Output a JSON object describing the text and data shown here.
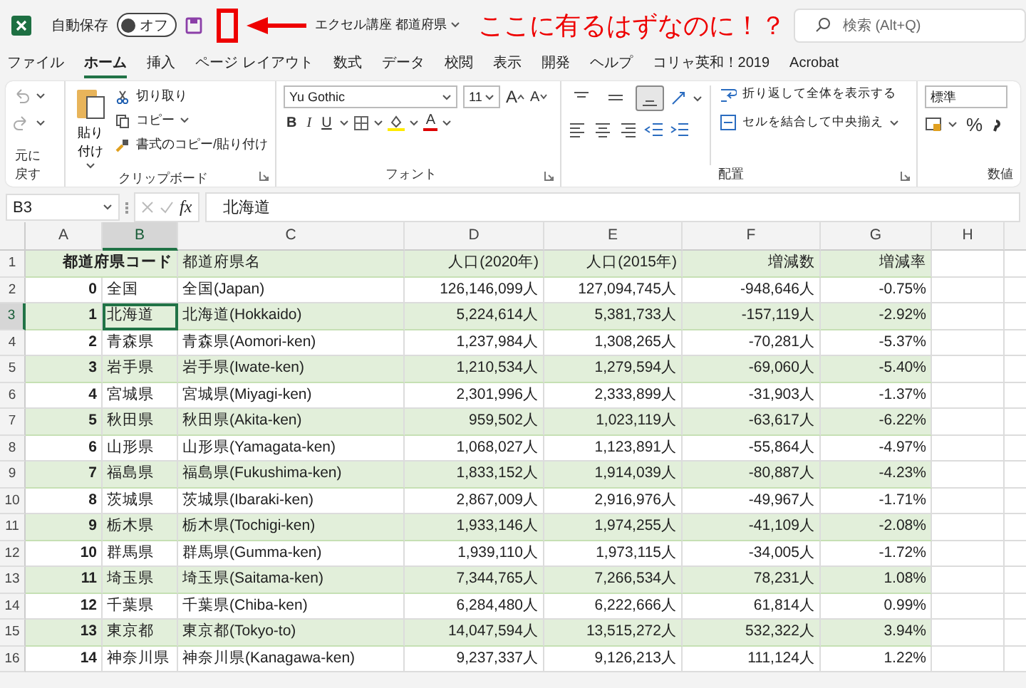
{
  "title_bar": {
    "autosave_label": "自動保存",
    "autosave": {
      "label": "オフ",
      "on": false
    },
    "document_title": "エクセル講座 都道府県",
    "search_placeholder": "検索 (Alt+Q)"
  },
  "annotation": {
    "text": "ここに有るはずなのに！？"
  },
  "ribbon_tabs": [
    {
      "label": "ファイル",
      "selected": false
    },
    {
      "label": "ホーム",
      "selected": true
    },
    {
      "label": "挿入",
      "selected": false
    },
    {
      "label": "ページ レイアウト",
      "selected": false
    },
    {
      "label": "数式",
      "selected": false
    },
    {
      "label": "データ",
      "selected": false
    },
    {
      "label": "校閲",
      "selected": false
    },
    {
      "label": "表示",
      "selected": false
    },
    {
      "label": "開発",
      "selected": false
    },
    {
      "label": "ヘルプ",
      "selected": false
    },
    {
      "label": "コリャ英和！2019",
      "selected": false
    },
    {
      "label": "Acrobat",
      "selected": false
    }
  ],
  "ribbon": {
    "undo_group": "元に戻す",
    "clipboard": {
      "paste": "貼り付け",
      "cut": "切り取り",
      "copy": "コピー",
      "format_painter": "書式のコピー/貼り付け",
      "label": "クリップボード"
    },
    "font": {
      "name": "Yu Gothic",
      "size": "11",
      "bold": "B",
      "italic": "I",
      "underline": "U",
      "grow": "A",
      "shrink": "A",
      "font_color_button": "A",
      "label": "フォント"
    },
    "alignment": {
      "vertical": [
        {
          "selected": false
        },
        {
          "selected": false
        },
        {
          "selected": true
        }
      ],
      "wrap": "折り返して全体を表示する",
      "merge": "セルを結合して中央揃え",
      "label": "配置"
    },
    "number": {
      "format": "標準",
      "percent": "%",
      "label": "数値"
    }
  },
  "formula_bar": {
    "name_box": "B3",
    "fx": "fx",
    "value": "北海道"
  },
  "sheet": {
    "columns": [
      {
        "label": "A",
        "selected": false
      },
      {
        "label": "B",
        "selected": true
      },
      {
        "label": "C",
        "selected": false
      },
      {
        "label": "D",
        "selected": false
      },
      {
        "label": "E",
        "selected": false
      },
      {
        "label": "F",
        "selected": false
      },
      {
        "label": "G",
        "selected": false
      },
      {
        "label": "H",
        "selected": false
      }
    ],
    "rows": [
      {
        "number": "1",
        "selected": false,
        "banded": true,
        "cells": [
          "都道府県コード",
          "",
          "都道府県名",
          "人口(2020年)",
          "人口(2015年)",
          "増減数",
          "増減率"
        ]
      },
      {
        "number": "2",
        "selected": false,
        "banded": false,
        "cells": [
          "0",
          "全国",
          "全国(Japan)",
          "126,146,099人",
          "127,094,745人",
          "-948,646人",
          "-0.75%"
        ]
      },
      {
        "number": "3",
        "selected": true,
        "banded": true,
        "cells": [
          "1",
          "北海道",
          "北海道(Hokkaido)",
          "5,224,614人",
          "5,381,733人",
          "-157,119人",
          "-2.92%"
        ]
      },
      {
        "number": "4",
        "selected": false,
        "banded": false,
        "cells": [
          "2",
          "青森県",
          "青森県(Aomori-ken)",
          "1,237,984人",
          "1,308,265人",
          "-70,281人",
          "-5.37%"
        ]
      },
      {
        "number": "5",
        "selected": false,
        "banded": true,
        "cells": [
          "3",
          "岩手県",
          "岩手県(Iwate-ken)",
          "1,210,534人",
          "1,279,594人",
          "-69,060人",
          "-5.40%"
        ]
      },
      {
        "number": "6",
        "selected": false,
        "banded": false,
        "cells": [
          "4",
          "宮城県",
          "宮城県(Miyagi-ken)",
          "2,301,996人",
          "2,333,899人",
          "-31,903人",
          "-1.37%"
        ]
      },
      {
        "number": "7",
        "selected": false,
        "banded": true,
        "cells": [
          "5",
          "秋田県",
          "秋田県(Akita-ken)",
          "959,502人",
          "1,023,119人",
          "-63,617人",
          "-6.22%"
        ]
      },
      {
        "number": "8",
        "selected": false,
        "banded": false,
        "cells": [
          "6",
          "山形県",
          "山形県(Yamagata-ken)",
          "1,068,027人",
          "1,123,891人",
          "-55,864人",
          "-4.97%"
        ]
      },
      {
        "number": "9",
        "selected": false,
        "banded": true,
        "cells": [
          "7",
          "福島県",
          "福島県(Fukushima-ken)",
          "1,833,152人",
          "1,914,039人",
          "-80,887人",
          "-4.23%"
        ]
      },
      {
        "number": "10",
        "selected": false,
        "banded": false,
        "cells": [
          "8",
          "茨城県",
          "茨城県(Ibaraki-ken)",
          "2,867,009人",
          "2,916,976人",
          "-49,967人",
          "-1.71%"
        ]
      },
      {
        "number": "11",
        "selected": false,
        "banded": true,
        "cells": [
          "9",
          "栃木県",
          "栃木県(Tochigi-ken)",
          "1,933,146人",
          "1,974,255人",
          "-41,109人",
          "-2.08%"
        ]
      },
      {
        "number": "12",
        "selected": false,
        "banded": false,
        "cells": [
          "10",
          "群馬県",
          "群馬県(Gumma-ken)",
          "1,939,110人",
          "1,973,115人",
          "-34,005人",
          "-1.72%"
        ]
      },
      {
        "number": "13",
        "selected": false,
        "banded": true,
        "cells": [
          "11",
          "埼玉県",
          "埼玉県(Saitama-ken)",
          "7,344,765人",
          "7,266,534人",
          "78,231人",
          "1.08%"
        ]
      },
      {
        "number": "14",
        "selected": false,
        "banded": false,
        "cells": [
          "12",
          "千葉県",
          "千葉県(Chiba-ken)",
          "6,284,480人",
          "6,222,666人",
          "61,814人",
          "0.99%"
        ]
      },
      {
        "number": "15",
        "selected": false,
        "banded": true,
        "cells": [
          "13",
          "東京都",
          "東京都(Tokyo-to)",
          "14,047,594人",
          "13,515,272人",
          "532,322人",
          "3.94%"
        ]
      },
      {
        "number": "16",
        "selected": false,
        "banded": false,
        "cells": [
          "14",
          "神奈川県",
          "神奈川県(Kanagawa-ken)",
          "9,237,337人",
          "9,126,213人",
          "111,124人",
          "1.22%"
        ]
      }
    ]
  }
}
